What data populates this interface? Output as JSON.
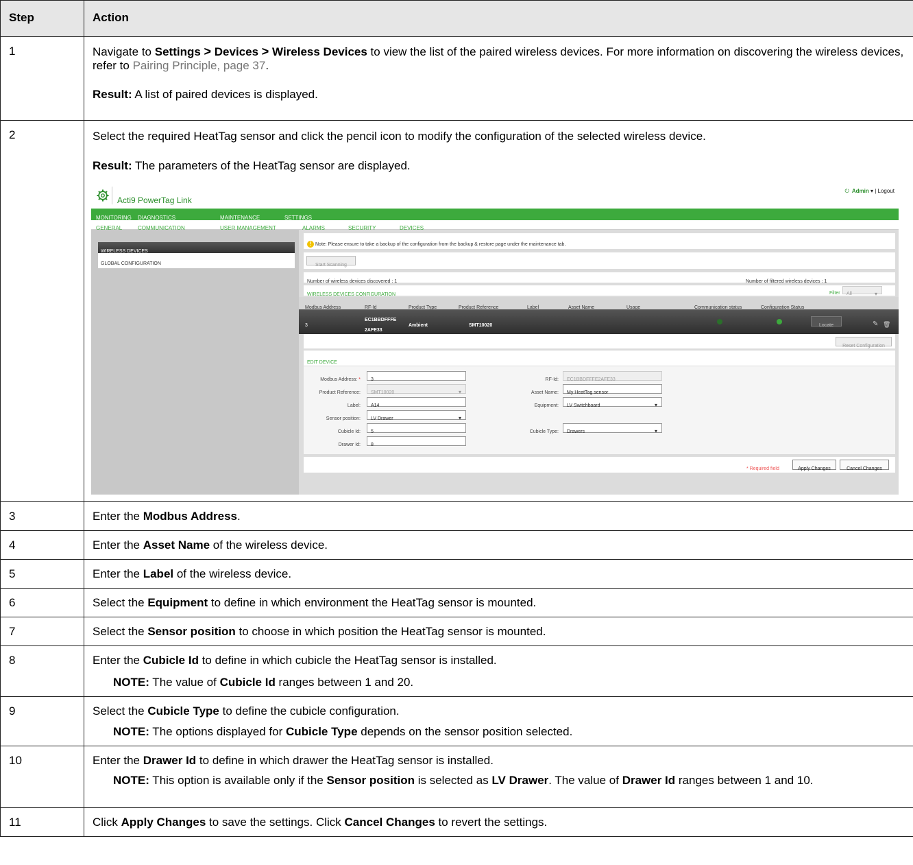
{
  "header": {
    "step": "Step",
    "action": "Action"
  },
  "rows": {
    "r1": {
      "step": "1",
      "t1": "Navigate to ",
      "b1": "Settings",
      "gt1": ">",
      "b2": "Devices",
      "gt2": ">",
      "b3": "Wireless Devices",
      "t2": " to view the list of the paired wireless devices. For more information on discovering the wireless devices, refer to ",
      "link": "Pairing Principle, page 37",
      "t3": ".",
      "result_label": "Result:",
      "result_text": " A list of paired devices is displayed."
    },
    "r2": {
      "step": "2",
      "t1": "Select the required HeatTag sensor and click the pencil icon to modify the configuration of the selected wireless device.",
      "result_label": "Result:",
      "result_text": " The parameters of the HeatTag sensor are displayed."
    },
    "r3": {
      "step": "3",
      "t1": "Enter the ",
      "b1": "Modbus Address",
      "t2": "."
    },
    "r4": {
      "step": "4",
      "t1": "Enter the ",
      "b1": "Asset Name",
      "t2": " of the wireless device."
    },
    "r5": {
      "step": "5",
      "t1": "Enter the ",
      "b1": "Label",
      "t2": " of the wireless device."
    },
    "r6": {
      "step": "6",
      "t1": "Select the ",
      "b1": "Equipment",
      "t2": " to define in which environment the HeatTag sensor is mounted."
    },
    "r7": {
      "step": "7",
      "t1": "Select the ",
      "b1": "Sensor position",
      "t2": " to choose in which position the HeatTag sensor is mounted."
    },
    "r8": {
      "step": "8",
      "t1": "Enter the ",
      "b1": "Cubicle Id",
      "t2": " to define in which cubicle the HeatTag sensor is installed.",
      "note_label": "NOTE:",
      "n1": " The value of ",
      "nb1": "Cubicle Id",
      "n2": " ranges between 1 and 20."
    },
    "r9": {
      "step": "9",
      "t1": "Select the ",
      "b1": "Cubicle Type",
      "t2": " to define the cubicle configuration.",
      "note_label": "NOTE:",
      "n1": " The options displayed for ",
      "nb1": "Cubicle Type",
      "n2": " depends on the sensor position selected."
    },
    "r10": {
      "step": "10",
      "t1": "Enter the ",
      "b1": "Drawer Id",
      "t2": " to define in which drawer the HeatTag sensor is installed.",
      "note_label": "NOTE:",
      "n1": " This option is available only if the ",
      "nb1": "Sensor position",
      "n2": " is selected as ",
      "nb2": "LV Drawer",
      "n3": ". The value of ",
      "nb3": "Drawer Id",
      "n4": " ranges between 1 and 10."
    },
    "r11": {
      "step": "11",
      "t1": "Click ",
      "b1": "Apply Changes",
      "t2": " to save the settings. Click ",
      "b2": "Cancel Changes",
      "t3": " to revert the settings."
    }
  },
  "screenshot": {
    "app_title": "Acti9 PowerTag Link",
    "user": {
      "admin": "Admin",
      "caret": "▾",
      "sep": "|",
      "logout": "Logout"
    },
    "nav_main": [
      "MONITORING",
      "DIAGNOSTICS",
      "MAINTENANCE",
      "SETTINGS"
    ],
    "nav_sub": [
      "GENERAL",
      "COMMUNICATION",
      "USER MANAGEMENT",
      "ALARMS",
      "SECURITY",
      "DEVICES"
    ],
    "sidebar": {
      "wireless_devices": "WIRELESS DEVICES",
      "global_configuration": "GLOBAL CONFIGURATION"
    },
    "note_text": "Note: Please ensure to take a backup of the configuration from the backup & restore page under the maintenance tab.",
    "start_scanning": "Start Scanning",
    "discovered": "Number of wireless devices discovered : 1",
    "filtered": "Number of filtered wireless devices : 1",
    "config_title": "WIRELESS DEVICES CONFIGURATION",
    "filter_label": "Filter",
    "filter_value": "All",
    "columns": [
      "Modbus Address",
      "RF-Id",
      "Product Type",
      "Product Reference",
      "Label",
      "Asset Name",
      "Usage",
      "Communication status",
      "Configuration Status"
    ],
    "device_row": {
      "modbus": "3",
      "rfid_line1": "EC1BBDFFFE",
      "rfid_line2": "2AFE33",
      "product_type": "Ambient",
      "product_reference": "SMT10020",
      "locate": "Locate"
    },
    "reset_configuration": "Reset Configuration",
    "edit_title": "EDIT DEVICE",
    "form": {
      "modbus_label": "Modbus Address:",
      "modbus_req": "*",
      "modbus_value": "3",
      "rfid_label": "RF-Id:",
      "rfid_value": "EC1BBDFFFE2AFE33",
      "product_ref_label": "Product Reference:",
      "product_ref_value": "SMT10020",
      "asset_label": "Asset Name:",
      "asset_value": "My HeatTag sensor",
      "label_label": "Label:",
      "label_value": "A14",
      "equipment_label": "Equipment:",
      "equipment_value": "LV Switchboard",
      "sensor_pos_label": "Sensor position:",
      "sensor_pos_value": "LV Drawer",
      "cubicle_id_label": "Cubicle Id:",
      "cubicle_id_value": "5",
      "cubicle_type_label": "Cubicle Type:",
      "cubicle_type_value": "Drawers",
      "drawer_id_label": "Drawer Id:",
      "drawer_id_value": "8"
    },
    "required_field": "* Required field",
    "apply_changes": "Apply Changes",
    "cancel_changes": "Cancel Changes",
    "colors": {
      "brand_green": "#3daa3d",
      "dark_row": "#333333",
      "warning": "#f2c200"
    },
    "icons": [
      "gear-icon",
      "power-icon",
      "warning-icon",
      "check-icon",
      "pencil-icon",
      "trash-icon"
    ]
  }
}
